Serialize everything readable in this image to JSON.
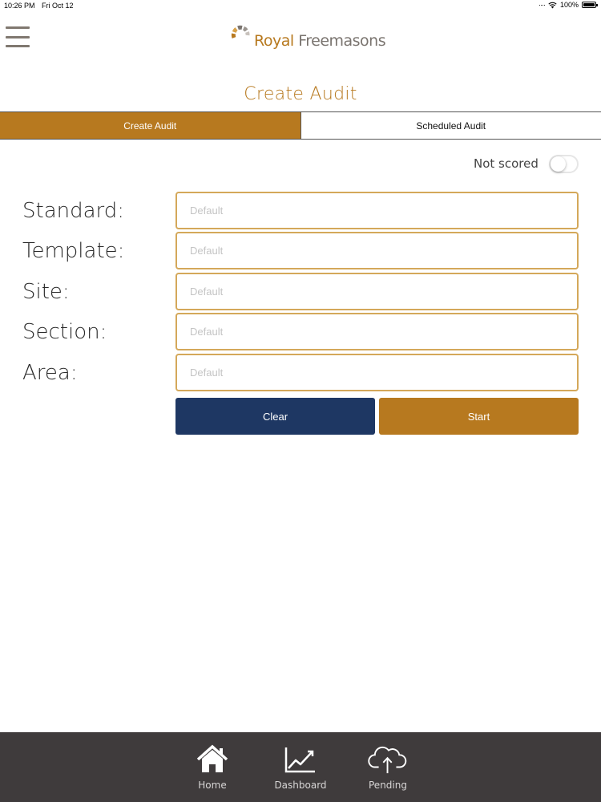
{
  "status_bar": {
    "time": "10:26 PM",
    "date": "Fri Oct 12",
    "battery": "100%"
  },
  "header": {
    "logo_royal": "Royal",
    "logo_freemasons": "Freemasons",
    "menu_icon": "hamburger-icon"
  },
  "page": {
    "title": "Create Audit"
  },
  "tabs": [
    {
      "label": "Create Audit",
      "active": true
    },
    {
      "label": "Scheduled Audit",
      "active": false
    }
  ],
  "toggle": {
    "label": "Not scored",
    "on": false
  },
  "form": {
    "fields": [
      {
        "label": "Standard:",
        "placeholder": "Default",
        "value": ""
      },
      {
        "label": "Template:",
        "placeholder": "Default",
        "value": ""
      },
      {
        "label": "Site:",
        "placeholder": "Default",
        "value": ""
      },
      {
        "label": "Section:",
        "placeholder": "Default",
        "value": ""
      },
      {
        "label": "Area:",
        "placeholder": "Default",
        "value": ""
      }
    ],
    "clear_label": "Clear",
    "start_label": "Start"
  },
  "bottom_nav": [
    {
      "label": "Home",
      "icon": "home-icon"
    },
    {
      "label": "Dashboard",
      "icon": "chart-line-icon"
    },
    {
      "label": "Pending",
      "icon": "cloud-upload-icon"
    }
  ],
  "colors": {
    "accent": "#b7791f",
    "navy": "#1e3763",
    "nav_bg": "#3f3b3c",
    "input_border": "#d4a85a"
  }
}
